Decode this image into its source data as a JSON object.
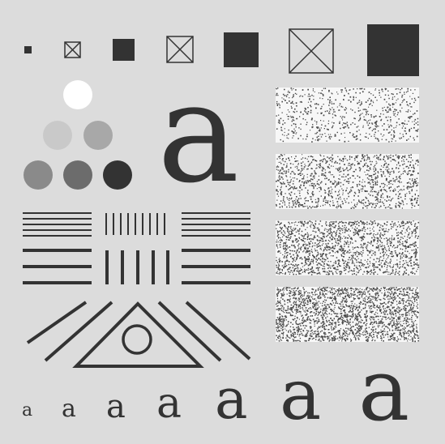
{
  "colors": {
    "background": "#dcdcdc",
    "ink": "#333333",
    "noise_band": "#f7f7f7",
    "gray_swatches": [
      "#ffffff",
      "#c9c9c9",
      "#a8a8a8",
      "#8a8a8a",
      "#6c6c6c",
      "#333333"
    ]
  },
  "glyph": {
    "letter": "a"
  },
  "noise_panels": {
    "densities": [
      0.18,
      0.3,
      0.42,
      0.55
    ]
  }
}
